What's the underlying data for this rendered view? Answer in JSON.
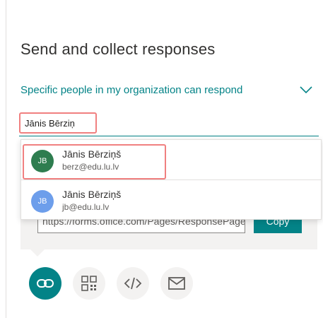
{
  "panel": {
    "title": "Send and collect responses",
    "audience_dropdown": {
      "selected": "Specific people in my organization can respond"
    },
    "search": {
      "value": "Jānis Bērziņ"
    },
    "suggestions": [
      {
        "initials": "JB",
        "name": "Jānis Bērziņš",
        "email": "berz@edu.lu.lv",
        "avatar_color": "#2e7d4f",
        "highlighted": true
      },
      {
        "initials": "JB",
        "name": "Jānis Bērziņš",
        "email": "jb@edu.lu.lv",
        "avatar_color": "#6d9eeb",
        "highlighted": false
      }
    ],
    "link": {
      "url": "https://forms.office.com/Pages/ResponsePage.aspx",
      "copy_label": "Copy"
    },
    "share_options": [
      {
        "icon": "link-icon",
        "active": true
      },
      {
        "icon": "qr-code-icon",
        "active": false
      },
      {
        "icon": "embed-code-icon",
        "active": false
      },
      {
        "icon": "mail-icon",
        "active": false
      }
    ],
    "accent_color": "#038387",
    "highlight_color": "#f08080"
  }
}
